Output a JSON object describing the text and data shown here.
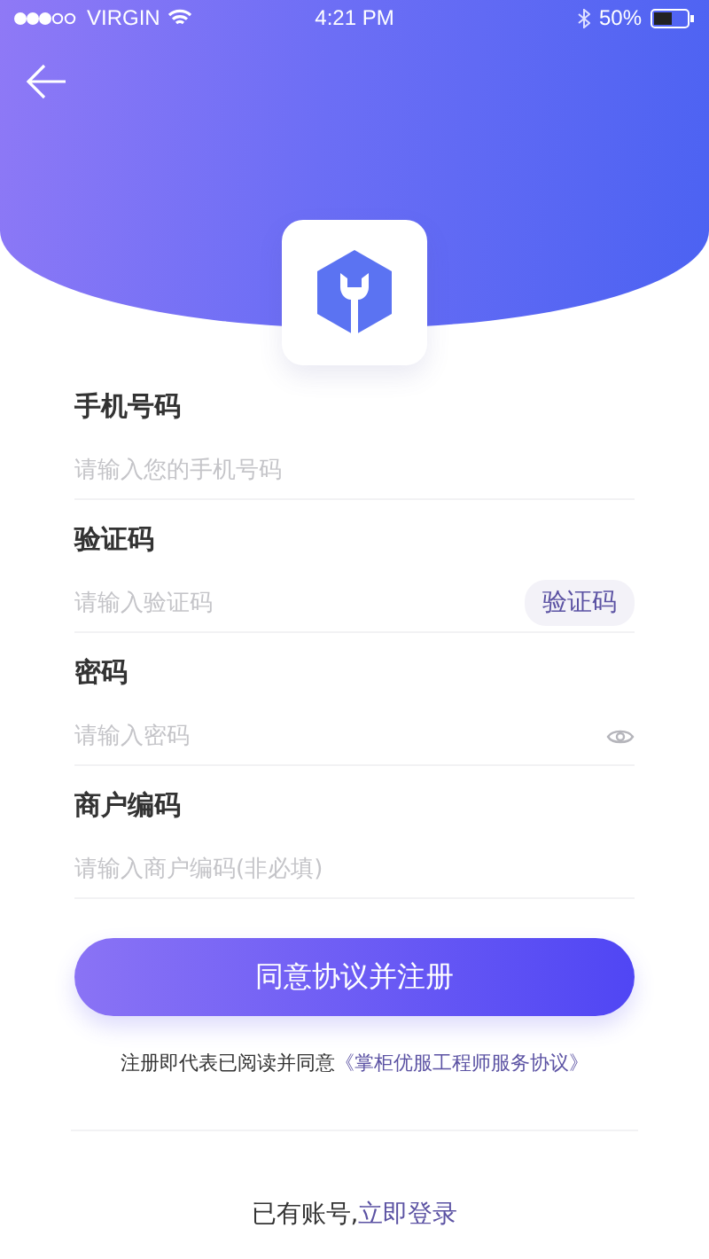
{
  "status_bar": {
    "carrier": "VIRGIN",
    "time": "4:21 PM",
    "battery": "50%"
  },
  "fields": [
    {
      "kind": "text",
      "label": "手机号码",
      "placeholder": "请输入您的手机号码"
    },
    {
      "kind": "code",
      "label": "验证码",
      "placeholder": "请输入验证码",
      "button": "验证码"
    },
    {
      "kind": "password",
      "label": "密码",
      "placeholder": "请输入密码"
    },
    {
      "kind": "text",
      "label": "商户编码",
      "placeholder": "请输入商户编码(非必填)"
    }
  ],
  "submit_button": "同意协议并注册",
  "agreement": {
    "text": "注册即代表已阅读并同意",
    "link": "《掌柜优服工程师服务协议》"
  },
  "login_prompt": {
    "text": "已有账号,",
    "link": "立即登录"
  }
}
